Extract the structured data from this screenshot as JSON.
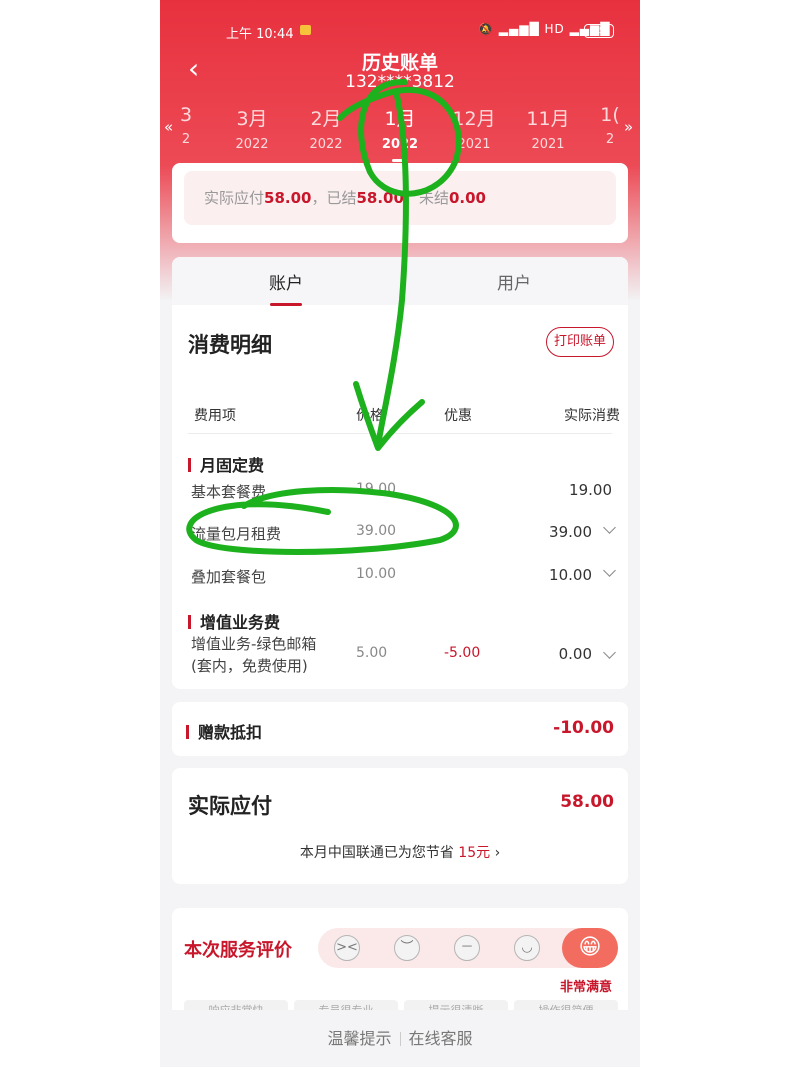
{
  "status_bar": {
    "time": "上午 10:44",
    "icons": "🔕 ▂▄▆█ HD ▂▄▆█",
    "battery": "95"
  },
  "header": {
    "title": "历史账单",
    "phone": "132****3812",
    "back_icon": "chevron-left-icon"
  },
  "months": [
    {
      "m": "3",
      "y": "2"
    },
    {
      "m": "3月",
      "y": "2022"
    },
    {
      "m": "2月",
      "y": "2022"
    },
    {
      "m": "1月",
      "y": "2022"
    },
    {
      "m": "12月",
      "y": "2021"
    },
    {
      "m": "11月",
      "y": "2021"
    },
    {
      "m": "1(",
      "y": "2"
    }
  ],
  "month_scroll": {
    "left": "«",
    "right": "»"
  },
  "summary": {
    "due_label": "实际应付",
    "due": "58.00",
    "settled_label": "，已结",
    "settled": "58.00",
    "unsettled_label": "，未结",
    "unsettled": "0.00"
  },
  "tabs": [
    "账户",
    "用户"
  ],
  "detail": {
    "title": "消费明细",
    "print_button": "打印账单",
    "columns": [
      "费用项",
      "价格",
      "优惠",
      "实际消费"
    ],
    "groups": [
      {
        "label": "月固定费",
        "rows": [
          {
            "name": "基本套餐费",
            "price": "19.00",
            "discount": "",
            "actual": "19.00"
          },
          {
            "name": "流量包月租费",
            "price": "39.00",
            "discount": "",
            "actual": "39.00"
          },
          {
            "name": "叠加套餐包",
            "price": "10.00",
            "discount": "",
            "actual": "10.00"
          }
        ]
      },
      {
        "label": "增值业务费",
        "rows": [
          {
            "name_line1": "增值业务-绿色邮箱",
            "name_line2": "(套内，免费使用)",
            "price": "5.00",
            "discount": "-5.00",
            "actual": "0.00"
          }
        ]
      }
    ]
  },
  "gift": {
    "label": "赠款抵扣",
    "value": "-10.00"
  },
  "payment": {
    "label": "实际应付",
    "value": "58.00",
    "saving_prefix": "本月中国联通已为您节省 ",
    "saving_amount": "15元",
    "saving_arrow": "›"
  },
  "rating": {
    "label": "本次服务评价",
    "selected": "非常满意",
    "faces": [
      "angry-face-icon",
      "sad-face-icon",
      "neutral-face-icon",
      "smile-face-icon",
      "grin-face-icon"
    ],
    "chips": [
      "响应非常快",
      "专员很专业",
      "提示很清晰",
      "操作很简便"
    ]
  },
  "footer": {
    "tip": "温馨提示",
    "service": "在线客服"
  },
  "colors": {
    "brand": "#e8313f",
    "accent": "#c8162b",
    "annotation": "#1db11d"
  }
}
